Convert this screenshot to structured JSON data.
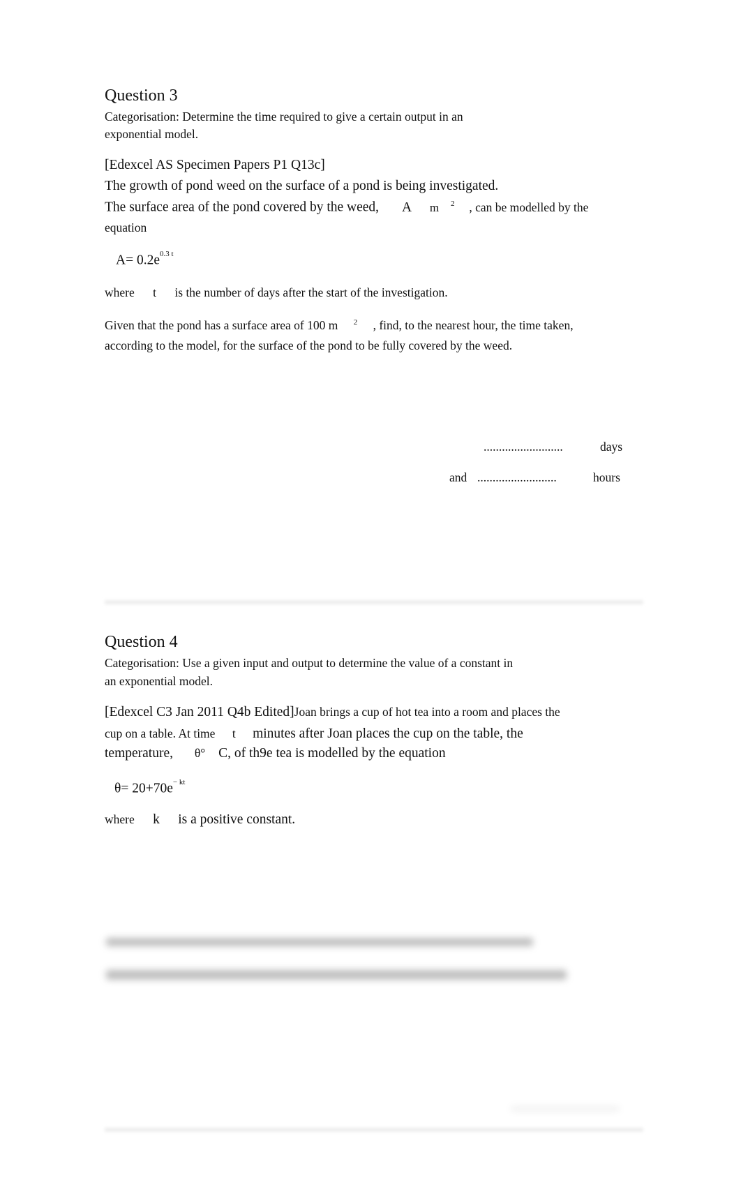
{
  "q3": {
    "title": "Question 3",
    "cat1": "Categorisation: Determine the time required to give a certain output in an",
    "cat2": "exponential model.",
    "source": "[Edexcel AS Specimen Papers P1 Q13c]",
    "l1": " The growth of pond weed on the surface of a pond is being investigated.",
    "l2a": "The surface area of the pond covered by the weed,",
    "var_A": "A",
    "unit_m": "m",
    "sq": "2",
    "l2b": ", can be modelled by the",
    "l3": "equation",
    "eq_base": "A= 0.2e",
    "eq_exp": "0.3 t",
    "where": "where",
    "var_t": "t",
    "where_rest": "is the number of days after the start of the investigation.",
    "given_a": "Given that the pond has a surface area of 100 m",
    "given_sq": "2",
    "given_b": ", find, to the nearest hour, the time taken,",
    "given_c": "according to the model, for the surface of the pond to be fully covered by the weed.",
    "dots1": "..........................",
    "days": "days",
    "and": "and",
    "dots2": "..........................",
    "hours": "hours"
  },
  "q4": {
    "title": "Question 4",
    "cat1": "Categorisation: Use a given input and output to determine the value of a constant in",
    "cat2": "an exponential model.",
    "l1a": "[Edexcel C3 Jan 2011 Q4b Edited]",
    "l1b": "Joan brings a cup of hot tea into a room and places the",
    "l2a": "cup on a table. At time",
    "var_t": "t",
    "l2b": "minutes after Joan places the cup on the table, the",
    "l3a": "temperature,",
    "theta": "θ°",
    "l3b": "C, of th9e tea is modelled by the equation",
    "eq_base": "θ= 20+70e",
    "eq_exp": "− kt",
    "where": "where",
    "var_k": "k",
    "where_rest": "is a positive constant."
  }
}
